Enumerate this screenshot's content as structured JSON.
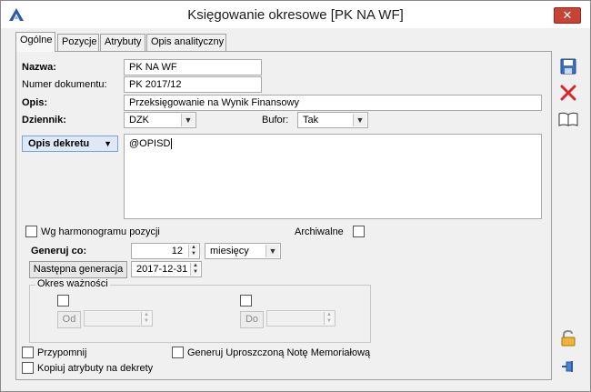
{
  "window": {
    "title": "Księgowanie okresowe [PK NA WF]",
    "close_label": "✕"
  },
  "tabs": [
    {
      "label": "Ogólne",
      "active": true
    },
    {
      "label": "Pozycje"
    },
    {
      "label": "Atrybuty"
    },
    {
      "label": "Opis analityczny"
    }
  ],
  "form": {
    "nazwa_label": "Nazwa:",
    "nazwa_value": "PK NA WF",
    "numer_label": "Numer dokumentu:",
    "numer_value": "PK 2017/12",
    "opis_label": "Opis:",
    "opis_value": "Przeksięgowanie na Wynik Finansowy",
    "dziennik_label": "Dziennik:",
    "dziennik_value": "DZK",
    "bufor_label": "Bufor:",
    "bufor_value": "Tak",
    "opis_dekretu_button": "Opis dekretu",
    "opis_dekretu_value": "@OPISD",
    "wg_harmonogramu_label": "Wg harmonogramu pozycji",
    "wg_harmonogramu_checked": false,
    "archiwalne_label": "Archiwalne",
    "archiwalne_checked": false,
    "generuj_co_label": "Generuj co:",
    "generuj_co_value": "12",
    "generuj_co_unit": "miesięcy",
    "nastepna_generacja_button": "Następna generacja",
    "nastepna_generacja_value": "2017-12-31",
    "okres_waznosci_title": "Okres ważności",
    "od_button": "Od",
    "od_value": "",
    "do_button": "Do",
    "do_value": "",
    "przypomnij_label": "Przypomnij",
    "generuj_nota_label": "Generuj Uproszczoną Notę Memoriałową",
    "kopiuj_atrybuty_label": "Kopiuj atrybuty na dekrety"
  },
  "side_buttons": {
    "save_icon": "save-icon",
    "delete_icon": "delete-icon",
    "book_icon": "book-icon",
    "lock_icon": "lock-icon",
    "pin_icon": "pin-icon"
  },
  "colors": {
    "accent_blue": "#2a5aa8",
    "close_red": "#c74333",
    "delete_red": "#d8262b"
  }
}
